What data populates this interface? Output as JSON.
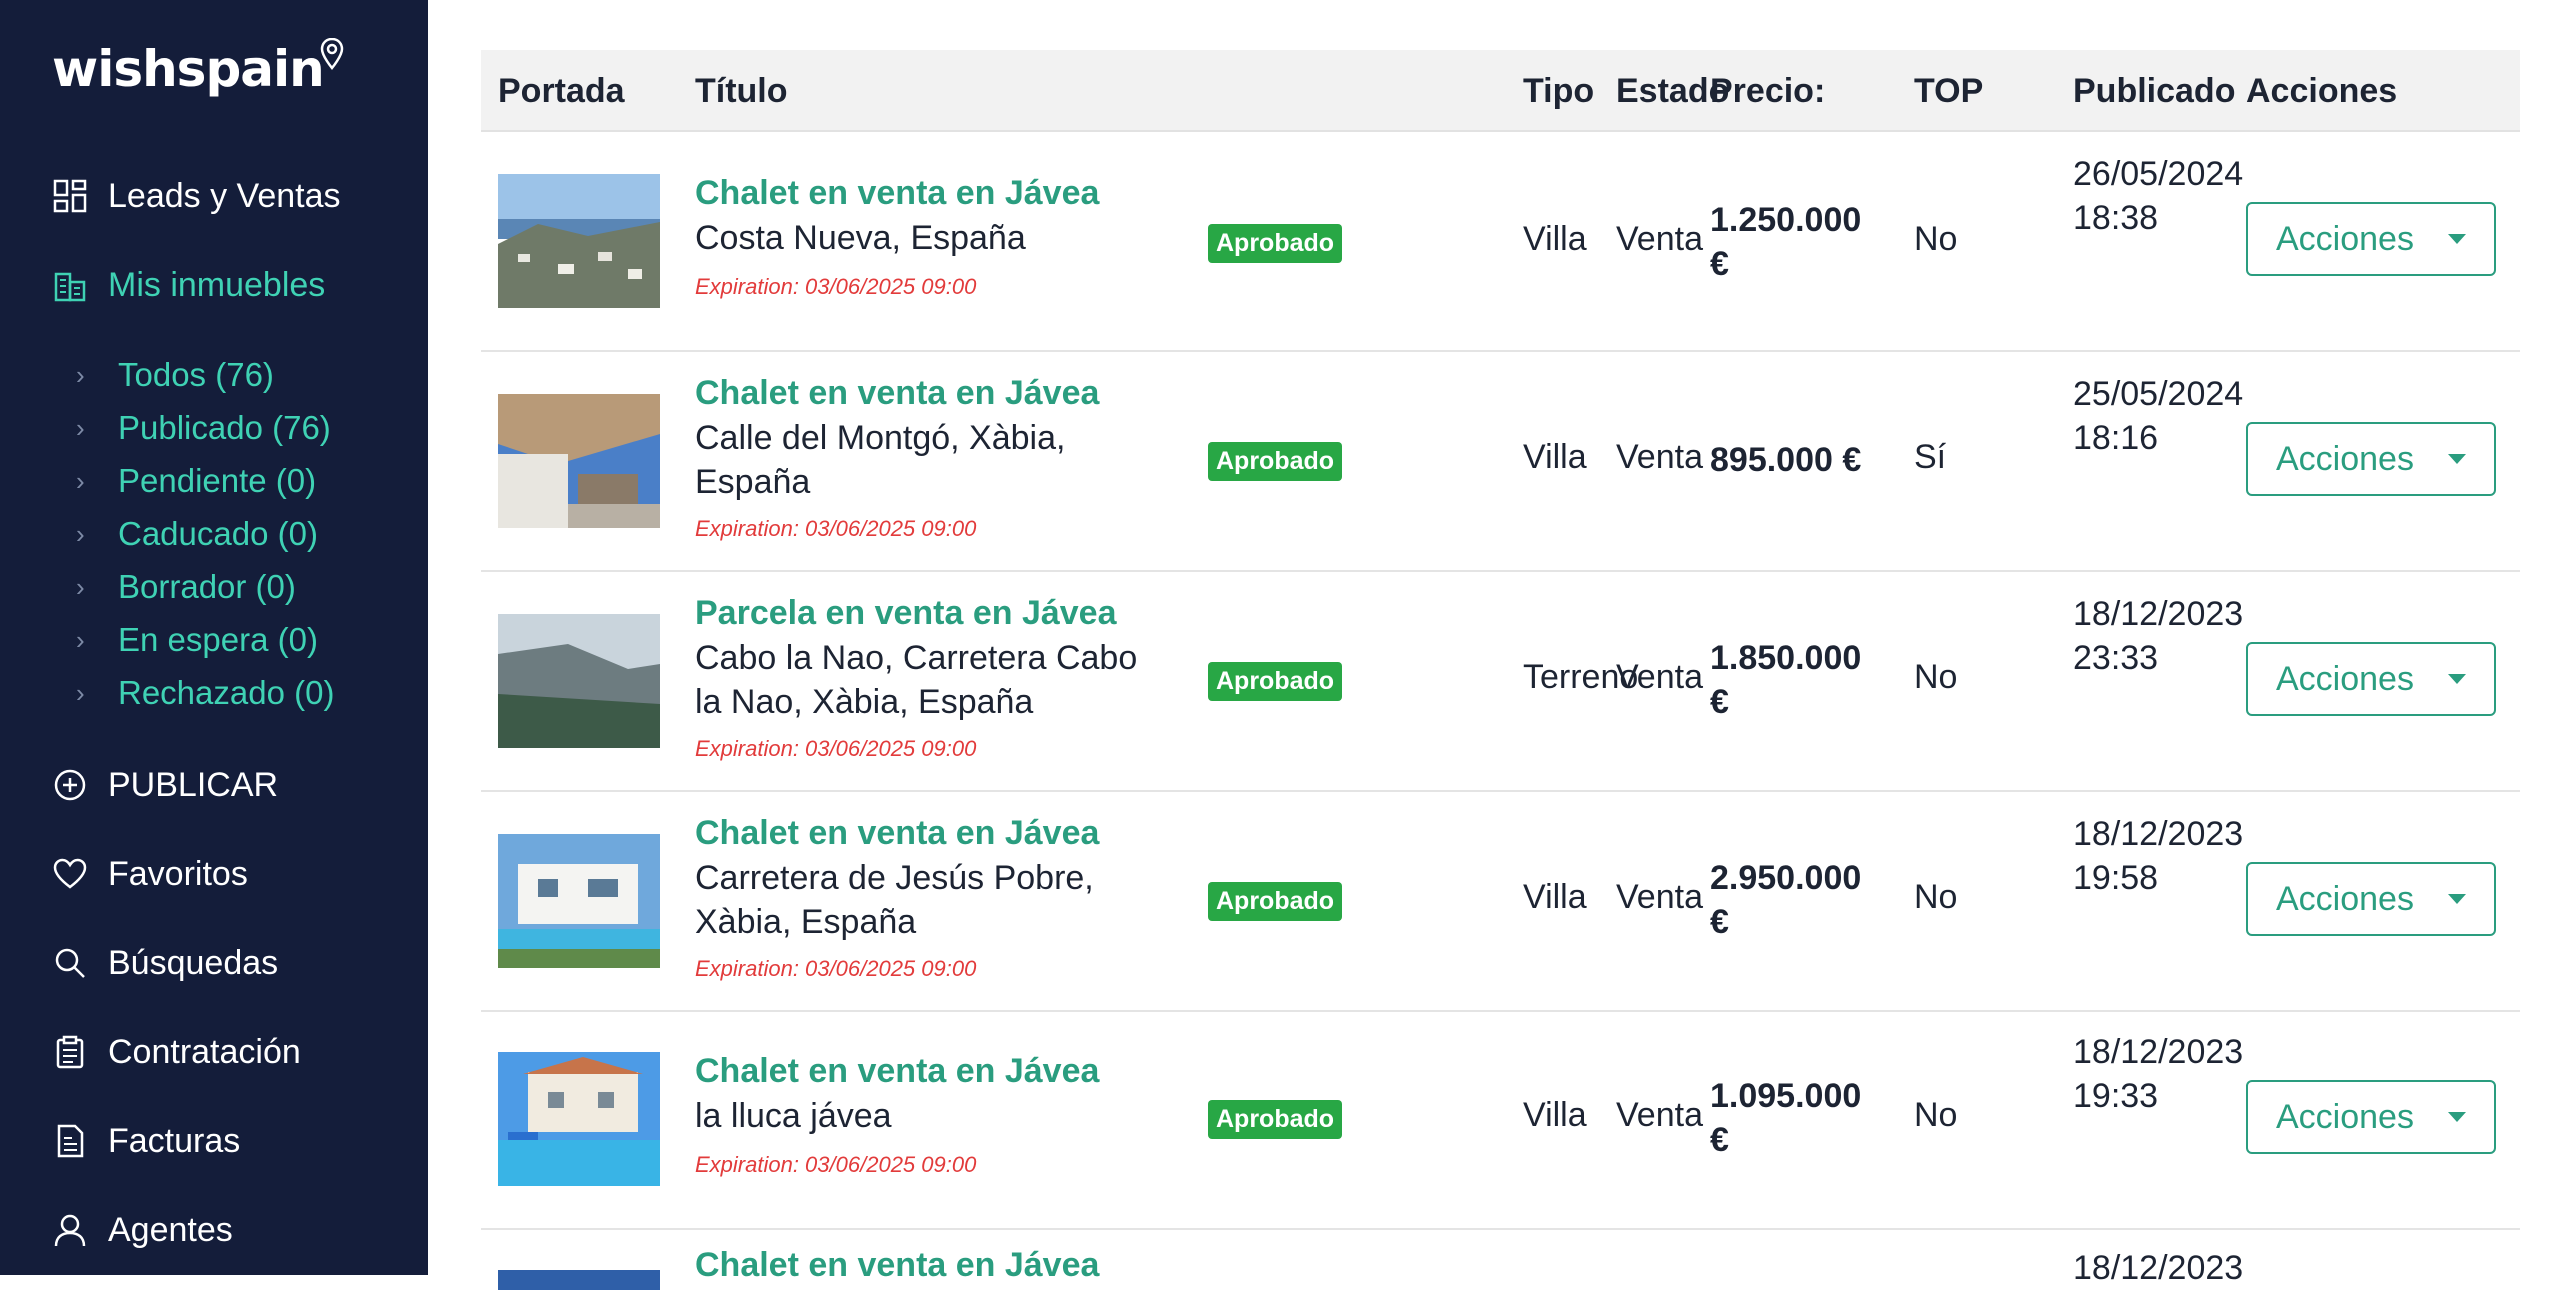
{
  "brand": {
    "logo_text": "wishspain"
  },
  "sidebar": {
    "items": [
      {
        "label": "Leads y Ventas",
        "icon": "dashboard-icon"
      },
      {
        "label": "Mis inmuebles",
        "icon": "building-icon",
        "active": true
      },
      {
        "label": "PUBLICAR",
        "icon": "plus-circle-icon"
      },
      {
        "label": "Favoritos",
        "icon": "heart-icon"
      },
      {
        "label": "Búsquedas",
        "icon": "search-icon"
      },
      {
        "label": "Contratación",
        "icon": "clipboard-icon"
      },
      {
        "label": "Facturas",
        "icon": "invoice-icon"
      },
      {
        "label": "Agentes",
        "icon": "user-icon"
      }
    ],
    "sub_items": [
      {
        "label": "Todos (76)"
      },
      {
        "label": "Publicado (76)"
      },
      {
        "label": "Pendiente (0)"
      },
      {
        "label": "Caducado (0)"
      },
      {
        "label": "Borrador (0)"
      },
      {
        "label": "En espera (0)"
      },
      {
        "label": "Rechazado (0)"
      }
    ]
  },
  "table": {
    "headers": {
      "cover": "Portada",
      "title": "Título",
      "type": "Tipo",
      "status": "Estado",
      "price": "Precio:",
      "top": "TOP",
      "published": "Publicado",
      "actions": "Acciones"
    },
    "rows": [
      {
        "title": "Chalet en venta en Jávea",
        "address": "Costa Nueva, España",
        "expiration": "Expiration: 03/06/2025 09:00",
        "badge": "Aprobado",
        "type": "Villa",
        "status": "Venta",
        "price": "1.250.000 €",
        "top": "No",
        "published": "26/05/2024 18:38",
        "action": "Acciones"
      },
      {
        "title": "Chalet en venta en Jávea",
        "address": "Calle del Montgó, Xàbia, España",
        "expiration": "Expiration: 03/06/2025 09:00",
        "badge": "Aprobado",
        "type": "Villa",
        "status": "Venta",
        "price": "895.000 €",
        "top": "Sí",
        "published": "25/05/2024 18:16",
        "action": "Acciones"
      },
      {
        "title": "Parcela en venta en Jávea",
        "address": "Cabo la Nao, Carretera Cabo la Nao, Xàbia, España",
        "expiration": "Expiration: 03/06/2025 09:00",
        "badge": "Aprobado",
        "type": "Terreno",
        "status": "Venta",
        "price": "1.850.000 €",
        "top": "No",
        "published": "18/12/2023 23:33",
        "action": "Acciones"
      },
      {
        "title": "Chalet en venta en Jávea",
        "address": "Carretera de Jesús Pobre, Xàbia, España",
        "expiration": "Expiration: 03/06/2025 09:00",
        "badge": "Aprobado",
        "type": "Villa",
        "status": "Venta",
        "price": "2.950.000 €",
        "top": "No",
        "published": "18/12/2023 19:58",
        "action": "Acciones"
      },
      {
        "title": "Chalet en venta en Jávea",
        "address": "la lluca jávea",
        "expiration": "Expiration: 03/06/2025 09:00",
        "badge": "Aprobado",
        "type": "Villa",
        "status": "Venta",
        "price": "1.095.000 €",
        "top": "No",
        "published": "18/12/2023 19:33",
        "action": "Acciones"
      },
      {
        "title": "Chalet en venta en Jávea",
        "published": "18/12/2023"
      }
    ]
  }
}
